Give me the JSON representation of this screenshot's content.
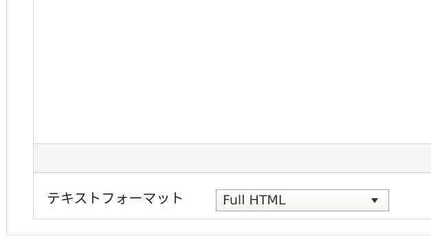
{
  "text_format": {
    "label": "テキストフォーマット",
    "selected_value": "Full HTML",
    "arrow_icon": "triangle-down-icon"
  }
}
